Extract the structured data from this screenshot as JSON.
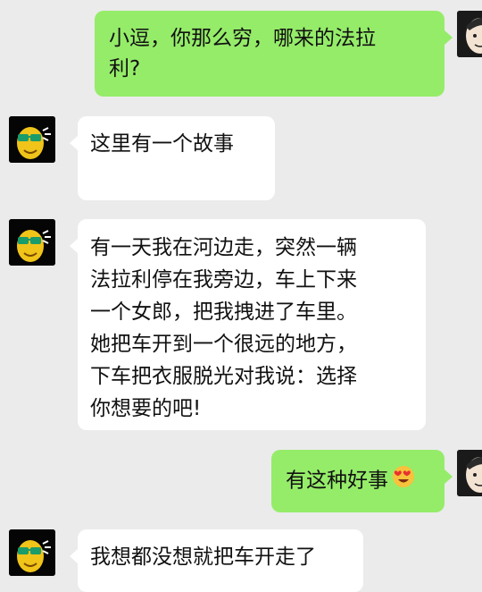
{
  "messages": [
    {
      "side": "right",
      "text": "小逗，你那么穷，哪来的法拉\n利?"
    },
    {
      "side": "left",
      "text": "这里有一个故事"
    },
    {
      "side": "left",
      "text": "有一天我在河边走，突然一辆\n法拉利停在我旁边，车上下来\n一个女郎，把我拽进了车里。\n她把车开到一个很远的地方，\n下车把衣服脱光对我说：选择\n你想要的吧!"
    },
    {
      "side": "right",
      "text": "有这种好事",
      "emoji": "heart-eyes-emoji"
    },
    {
      "side": "left",
      "text": "我想都没想就把车开走了"
    }
  ],
  "avatars": {
    "sender_avatar": "sunglasses-cartoon-avatar",
    "self_avatar": "sketch-face-avatar"
  },
  "colors": {
    "background": "#ebebeb",
    "incoming_bubble": "#ffffff",
    "outgoing_bubble": "#95ec69"
  }
}
